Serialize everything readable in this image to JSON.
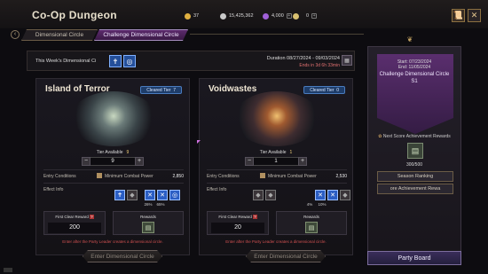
{
  "header": {
    "title": "Co-Op Dungeon",
    "resources": [
      {
        "icon": "gold-icon",
        "color": "#e0b040",
        "value": "37"
      },
      {
        "icon": "silver-coin-icon",
        "color": "#c9c9c9",
        "value": "15,425,362"
      },
      {
        "icon": "purple-gem-icon",
        "color": "#a060d8",
        "value": "4,000"
      },
      {
        "icon": "orb-icon",
        "color": "#d8c070",
        "value": "0"
      }
    ]
  },
  "tabs": [
    "Dimensional Circle",
    "Challenge Dimensional Circle"
  ],
  "weekly": {
    "label": "This Week's Dimensional Ci",
    "duration": "Duration 08/27/2024 - 09/03/2024",
    "ends_in": "Ends in 3d 6h 33min"
  },
  "cards": [
    {
      "title": "Island of Terror",
      "cleared": "Cleared Tier",
      "cleared_value": "7",
      "tier_available_label": "Tier Available",
      "tier_available": "9",
      "stepper_value": "9",
      "entry_label": "Entry Conditions",
      "power_label": "Minimum Combat Power",
      "power": "2,850",
      "effect_label": "Effect Info",
      "effect_pcts": [
        "26%",
        "65%"
      ],
      "first_clear_label": "First Clear Reward",
      "first_clear": "200",
      "rewards_label": "Rewards",
      "warning": "Enter after the Party Leader creates a dimensional circle.",
      "enter": "Enter Dimensional Circle"
    },
    {
      "title": "Voidwastes",
      "cleared": "Cleared Tier",
      "cleared_value": "0",
      "tier_available_label": "Tier Available",
      "tier_available": "1",
      "stepper_value": "1",
      "entry_label": "Entry Conditions",
      "power_label": "Minimum Combat Power",
      "power": "2,530",
      "effect_label": "Effect Info",
      "effect_pcts": [
        "4%",
        "10%"
      ],
      "first_clear_label": "First Clear Reward",
      "first_clear": "20",
      "rewards_label": "Rewards",
      "warning": "Enter after the Party Leader creates a dimensional circle.",
      "enter": "Enter Dimensional Circle"
    }
  ],
  "side": {
    "start": "Start: 07/23/2024",
    "end": "End: 11/05/2024",
    "title": "Challenge Dimensional Circle",
    "season": "S1",
    "next_reward": "Next Score Achievement Rewards",
    "progress": "300/500",
    "season_ranking": "Season Ranking",
    "achievement": "ore Achievement Rewa",
    "party_board": "Party Board"
  }
}
